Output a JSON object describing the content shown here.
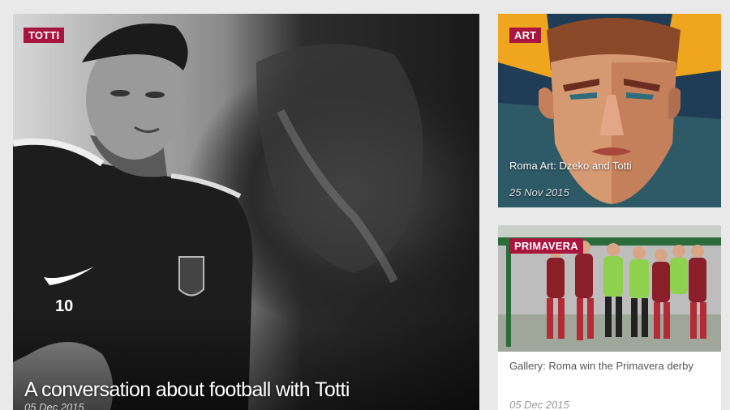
{
  "cards": [
    {
      "category": "TOTTI",
      "title": "A conversation about football with Totti",
      "date": "05 Dec 2015"
    },
    {
      "category": "ART",
      "title": "Roma Art: Dzeko and Totti",
      "date": "25 Nov 2015"
    },
    {
      "category": "PRIMAVERA",
      "title": "Gallery: Roma win the Primavera derby",
      "date": "05 Dec 2015"
    }
  ],
  "photo_detail": {
    "shirt_number": "10"
  },
  "colors": {
    "badge": "#a8153f",
    "page_bg": "#e9e9e9"
  }
}
